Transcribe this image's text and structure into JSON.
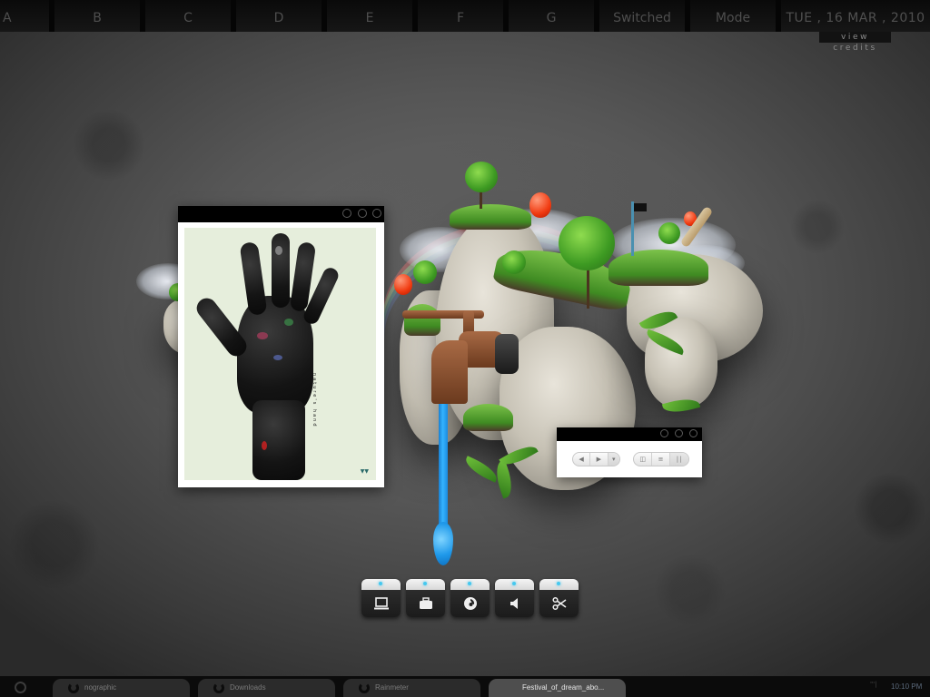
{
  "topbar": {
    "cells": [
      "A",
      "B",
      "C",
      "D",
      "E",
      "F",
      "G",
      "Switched",
      "Mode"
    ],
    "date": "TUE , 16 MAR , 2010",
    "view_credits": "view credits"
  },
  "viewer": {
    "artwork_caption": "nature's hand",
    "signature": "▼▼"
  },
  "player": {
    "nav_buttons": [
      "◀",
      "▶",
      "▾"
    ],
    "view_buttons": [
      "◫",
      "≡",
      "| |"
    ],
    "active_view_index": 2
  },
  "dock": {
    "items": [
      {
        "name": "computer",
        "icon": "laptop-icon"
      },
      {
        "name": "work",
        "icon": "briefcase-icon"
      },
      {
        "name": "firefox",
        "icon": "firefox-icon"
      },
      {
        "name": "volume",
        "icon": "speaker-icon"
      },
      {
        "name": "tools",
        "icon": "scissors-icon"
      }
    ]
  },
  "taskbar": {
    "tasks": [
      {
        "label": "nographic",
        "active": false
      },
      {
        "label": "Downloads",
        "active": false
      },
      {
        "label": "Rainmeter",
        "active": false
      },
      {
        "label": "Festival_of_dream_abo...",
        "active": true
      }
    ],
    "tray_icon": "\"'|",
    "clock": "10:10 PM"
  },
  "colors": {
    "accent_led": "#46c8ef",
    "water": "#34b4ff",
    "balloon": "#f03a10"
  }
}
